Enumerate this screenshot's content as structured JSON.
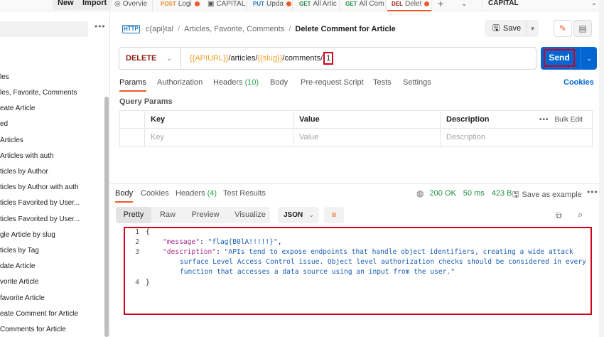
{
  "topbar": {
    "new_label": "New",
    "import_label": "Import",
    "tabs": [
      {
        "method": "",
        "title": "Overvie",
        "dot": false
      },
      {
        "method": "POST",
        "title": "POST Logi",
        "dot": true
      },
      {
        "method": "",
        "title": "CAPITAL",
        "dot": false
      },
      {
        "method": "PUT",
        "title": "PUT Upda",
        "dot": true
      },
      {
        "method": "GET",
        "title": "GET All Artic",
        "dot": false
      },
      {
        "method": "GET",
        "title": "GET All Com",
        "dot": false
      },
      {
        "method": "DEL",
        "title": "DEL Delet",
        "dot": true
      }
    ],
    "add_tab": "+",
    "environment": "CAPITAL",
    "colors": {
      "post": "#e98b27",
      "put": "#1a73b8",
      "get": "#1d8f41",
      "del": "#8e1a10",
      "accent": "#f05a28"
    }
  },
  "sidebar": {
    "more": "•••",
    "items": [
      "les",
      "les, Favorite, Comments",
      "eate Article",
      "ed",
      "Articles",
      "Articles with auth",
      "ticles by Author",
      "ticles by Author with auth",
      "ticles Favorited by User...",
      "ticles Favorited by User...",
      "gle Article by slug",
      "ticles by Tag",
      "date Article",
      "vorite Article",
      "favorite Article",
      "eate Comment for Article",
      "Comments for Article"
    ]
  },
  "header": {
    "http_badge": "HTTP",
    "crumbs": [
      "c{api}tal",
      "Articles, Favorite, Comments"
    ],
    "separator": "/",
    "current": "Delete Comment for Article",
    "save_label": "Save"
  },
  "request": {
    "method": "DELETE",
    "url_parts": {
      "var1": "{{APIURL}}",
      "path1": "/articles/",
      "var2": "{{slug}}",
      "path2": "/comments/",
      "highlight": "1"
    },
    "send_label": "Send",
    "tabs": [
      {
        "label": "Params",
        "count": ""
      },
      {
        "label": "Authorization",
        "count": ""
      },
      {
        "label": "Headers",
        "count": "(10)"
      },
      {
        "label": "Body",
        "count": ""
      },
      {
        "label": "Pre-request Script",
        "count": ""
      },
      {
        "label": "Tests",
        "count": ""
      },
      {
        "label": "Settings",
        "count": ""
      }
    ],
    "cookies_label": "Cookies",
    "query_params_title": "Query Params",
    "table": {
      "headers": [
        "Key",
        "Value",
        "Description"
      ],
      "bulk_edit": "Bulk Edit",
      "placeholders": [
        "Key",
        "Value",
        "Description"
      ]
    }
  },
  "response": {
    "tabs": [
      {
        "label": "Body",
        "count": ""
      },
      {
        "label": "Cookies",
        "count": ""
      },
      {
        "label": "Headers",
        "count": "(4)"
      },
      {
        "label": "Test Results",
        "count": ""
      }
    ],
    "status": "200 OK",
    "time": "50 ms",
    "size": "423 B",
    "save_example": "Save as example",
    "more": "•••",
    "formats": [
      "Pretty",
      "Raw",
      "Preview",
      "Visualize"
    ],
    "content_type": "JSON",
    "lines": [
      {
        "n": "1",
        "text": "{"
      },
      {
        "n": "2",
        "key": "\"message\"",
        "value": "\"flag{B0lA!!!!!}\"",
        "trail": ","
      },
      {
        "n": "3",
        "key": "\"description\"",
        "value": "\"APIs tend to expose endpoints that handle object identifiers, creating a wide attack",
        "trail": ""
      },
      {
        "n": "",
        "cont": "surface Level Access Control issue. Object level authorization checks should be considered in every"
      },
      {
        "n": "",
        "cont": "function that accesses a data source using an input from the user.\""
      },
      {
        "n": "4",
        "text": "}"
      }
    ]
  }
}
